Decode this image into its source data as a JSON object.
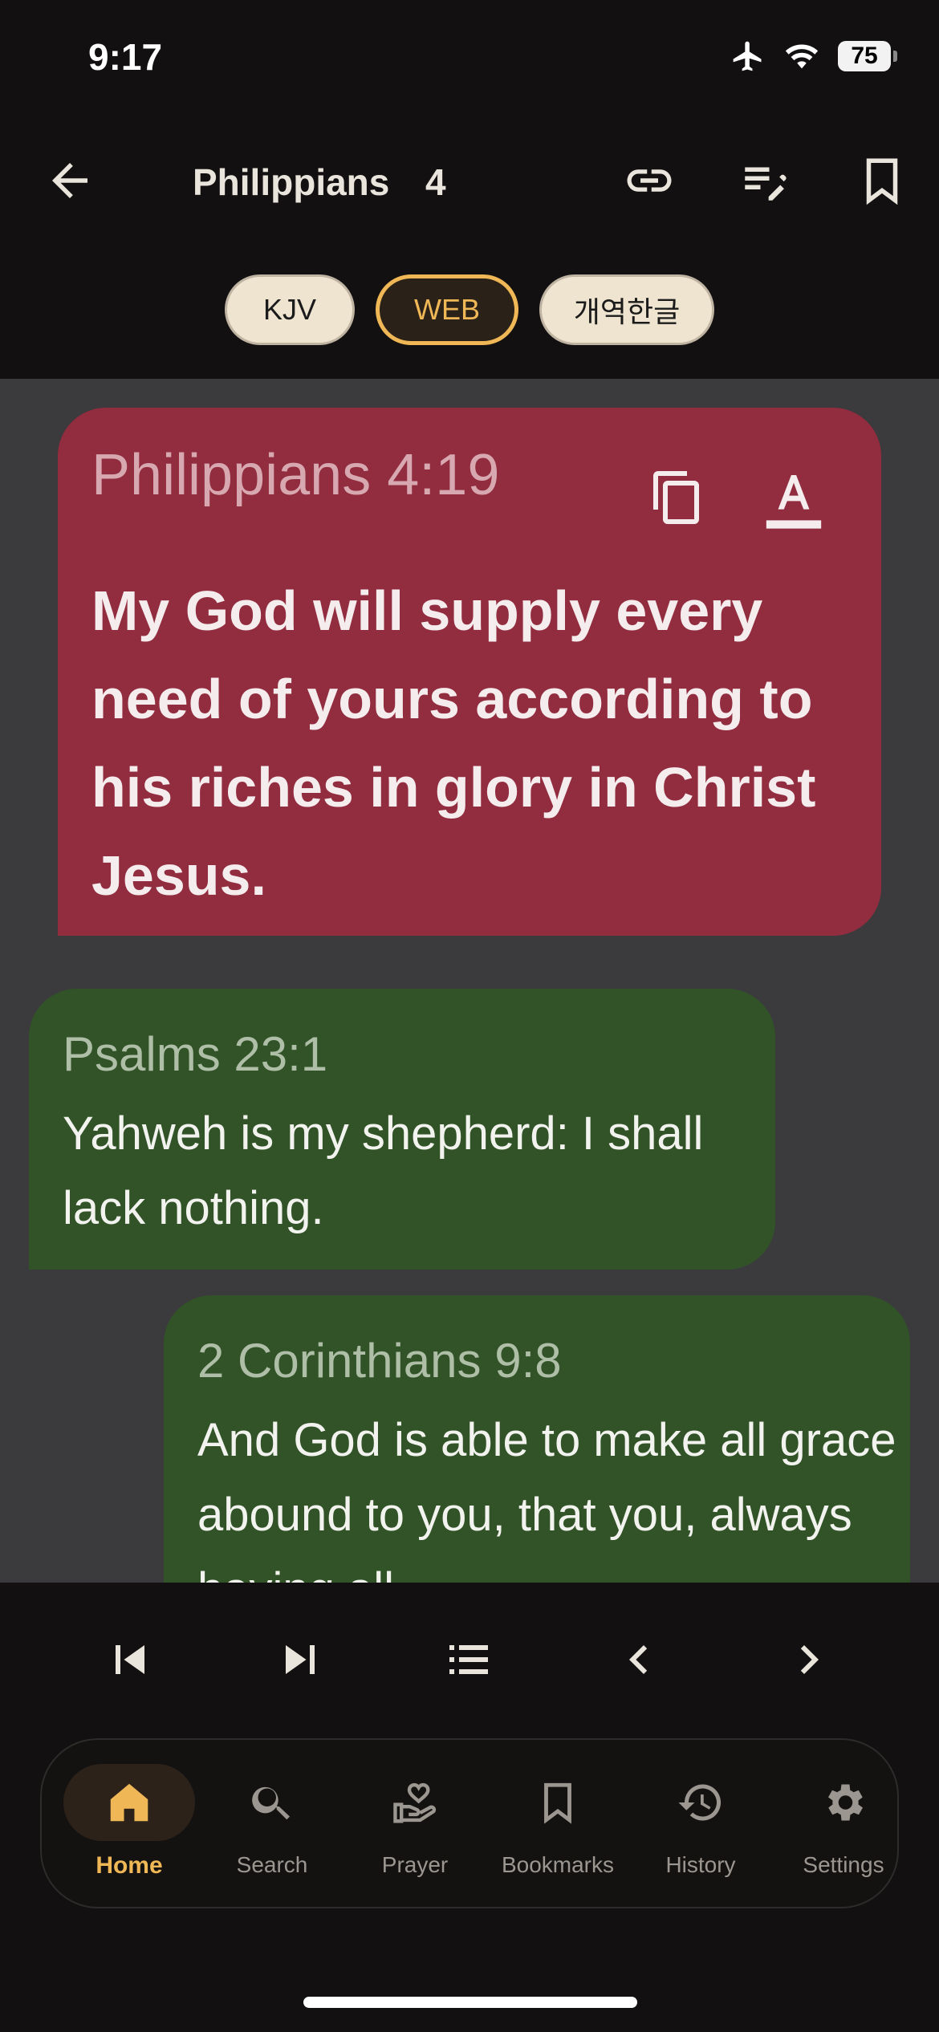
{
  "status_bar": {
    "time": "9:17",
    "battery": "75"
  },
  "app_bar": {
    "book": "Philippians",
    "chapter": "4"
  },
  "translations": [
    {
      "label": "KJV",
      "selected": false
    },
    {
      "label": "WEB",
      "selected": true
    },
    {
      "label": "개역한글",
      "selected": false
    }
  ],
  "featured_verse": {
    "reference": "Philippians 4:19",
    "text": "My God will supply every need of yours according to his riches in glory in Christ Jesus."
  },
  "related_verses": [
    {
      "reference": "Psalms 23:1",
      "text": "Yahweh is my shepherd: I shall lack nothing."
    },
    {
      "reference": "2 Corinthians 9:8",
      "text": "And God is able to make all grace abound to you, that you, always having all"
    }
  ],
  "bottom_nav": {
    "items": [
      {
        "label": "Home",
        "icon": "home-icon",
        "active": true
      },
      {
        "label": "Search",
        "icon": "search-icon",
        "active": false
      },
      {
        "label": "Prayer",
        "icon": "prayer-icon",
        "active": false
      },
      {
        "label": "Bookmarks",
        "icon": "bookmark-icon",
        "active": false
      },
      {
        "label": "History",
        "icon": "history-icon",
        "active": false
      },
      {
        "label": "Settings",
        "icon": "settings-icon",
        "active": false
      }
    ]
  },
  "colors": {
    "accent": "#f0b756",
    "featured_card": "#922c3f",
    "verse_card": "#315327",
    "content_bg": "#3b3b3d"
  }
}
